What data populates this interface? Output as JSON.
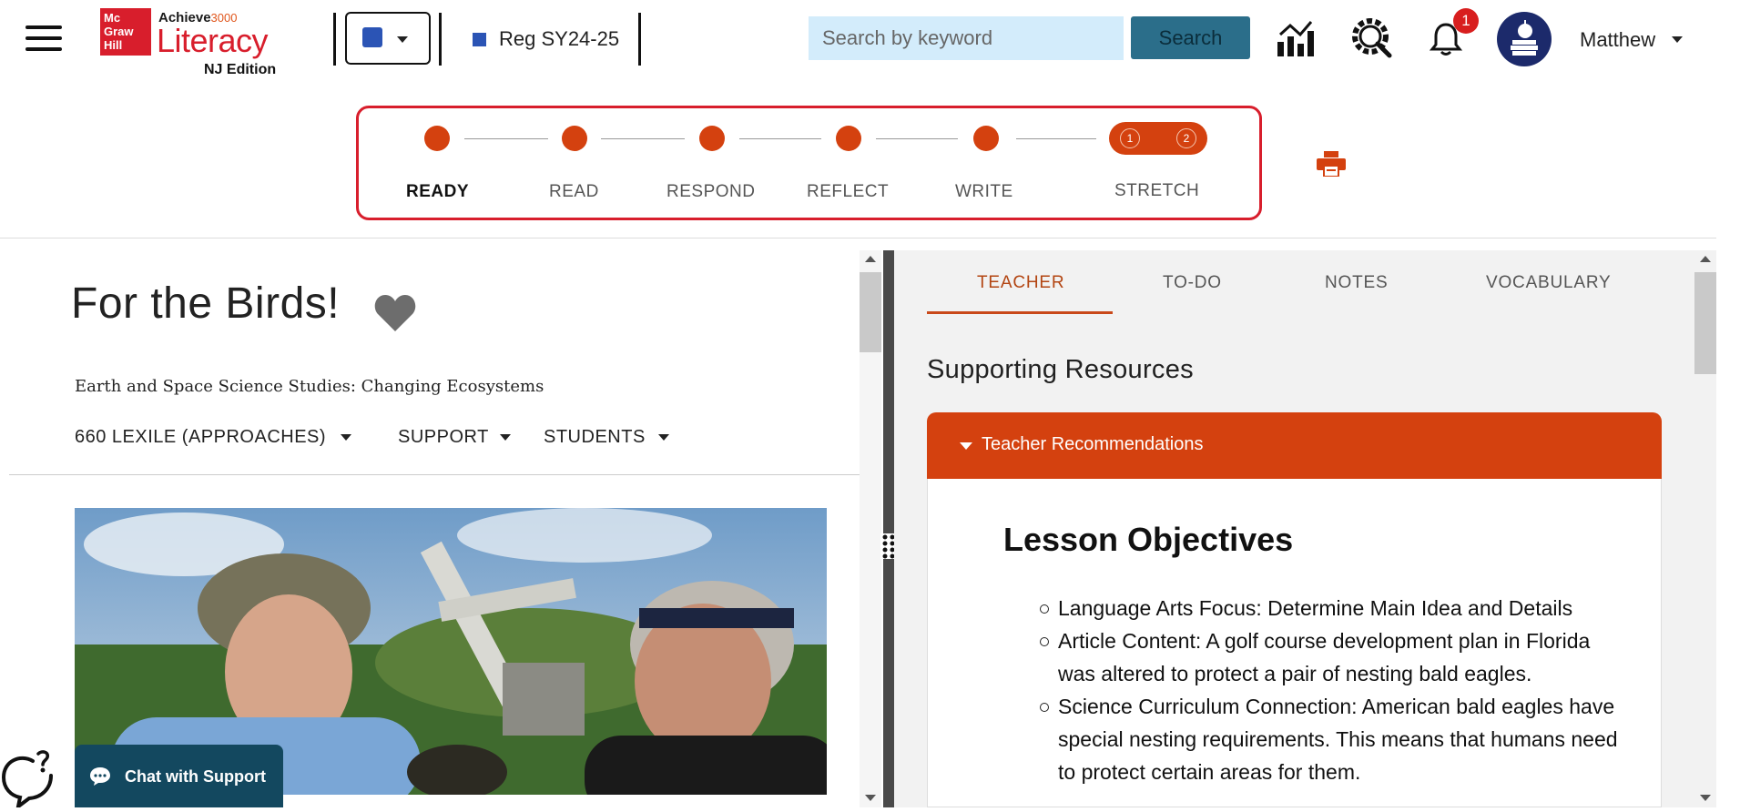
{
  "header": {
    "logo": {
      "brand_lines": [
        "Mc",
        "Graw",
        "Hill"
      ],
      "achieve": "Achieve",
      "achieve_num": "3000",
      "product": "Literacy",
      "edition": "NJ Edition"
    },
    "class_name": "Reg SY24-25",
    "search": {
      "placeholder": "Search by keyword",
      "button_label": "Search"
    },
    "notification_count": "1",
    "user_name": "Matthew"
  },
  "steps": [
    {
      "label": "READY",
      "active": true
    },
    {
      "label": "READ"
    },
    {
      "label": "RESPOND"
    },
    {
      "label": "REFLECT"
    },
    {
      "label": "WRITE"
    },
    {
      "label": "STRETCH",
      "parts": [
        "1",
        "2"
      ]
    }
  ],
  "article": {
    "title": "For the Birds!",
    "subtitle": "Earth and Space Science Studies: Changing Ecosystems",
    "dropdowns": {
      "lexile": "660 LEXILE (APPROACHES)",
      "support": "SUPPORT",
      "students": "STUDENTS"
    }
  },
  "chat": {
    "label": "Chat with Support"
  },
  "right_panel": {
    "tabs": [
      "TEACHER",
      "TO-DO",
      "NOTES",
      "VOCABULARY"
    ],
    "active_tab": "TEACHER",
    "section_title": "Supporting Resources",
    "accordion_label": "Teacher Recommendations",
    "lesson_objectives_title": "Lesson Objectives",
    "objectives": [
      "Language Arts Focus: Determine Main Idea and Details",
      "Article Content: A golf course development plan in Florida was altered to protect a pair of nesting bald eagles.",
      "Science Curriculum Connection: American bald eagles have special nesting requirements. This means that humans need to protect certain areas for them."
    ]
  },
  "colors": {
    "brand_red": "#d81e2c",
    "accent_orange": "#d4410f",
    "search_bg": "#d3ecfb",
    "search_button": "#2b6e8a",
    "chat_bg": "#13485f",
    "class_color": "#2b54b5"
  },
  "icons": [
    "menu-icon",
    "chevron-down-icon",
    "reports-chart-icon",
    "settings-search-icon",
    "bell-icon",
    "favorite-heart-icon",
    "print-icon",
    "chat-bubble-icon",
    "resize-handle-icon"
  ]
}
